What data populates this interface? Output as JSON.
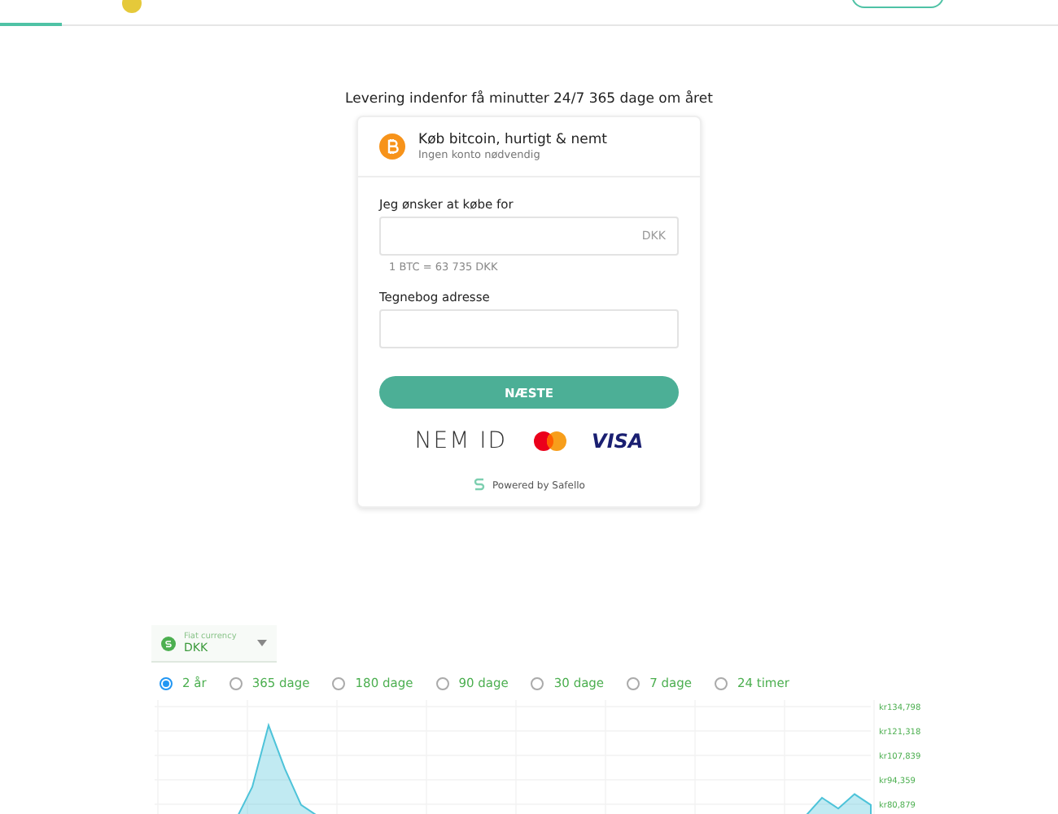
{
  "tagline": "Levering indenfor få minutter 24/7 365 dage om året",
  "card": {
    "title": "Køb bitcoin, hurtigt & nemt",
    "subtitle": "Ingen konto nødvendig",
    "amount_field": {
      "label": "Jeg ønsker at købe for",
      "suffix": "DKK"
    },
    "rate": "1 BTC = 63 735 DKK",
    "wallet_field": {
      "label": "Tegnebog adresse"
    },
    "submit": "NÆSTE",
    "payment_logos": [
      {
        "kind": "nemid",
        "text": "NEM ID"
      },
      {
        "kind": "mastercard"
      },
      {
        "kind": "visa",
        "text": "VISA"
      }
    ],
    "powered_by": "Powered by Safello"
  },
  "currency_select": {
    "label": "Fiat currency",
    "value": "DKK"
  },
  "ranges": [
    {
      "label": "2 år",
      "selected": true
    },
    {
      "label": "365 dage",
      "selected": false
    },
    {
      "label": "180 dage",
      "selected": false
    },
    {
      "label": "90 dage",
      "selected": false
    },
    {
      "label": "30 dage",
      "selected": false
    },
    {
      "label": "7 dage",
      "selected": false
    },
    {
      "label": "24 timer",
      "selected": false
    }
  ],
  "chart": {
    "y_axis_labels": [
      "kr134,798",
      "kr121,318",
      "kr107,839",
      "kr94,359",
      "kr80,879"
    ]
  }
}
